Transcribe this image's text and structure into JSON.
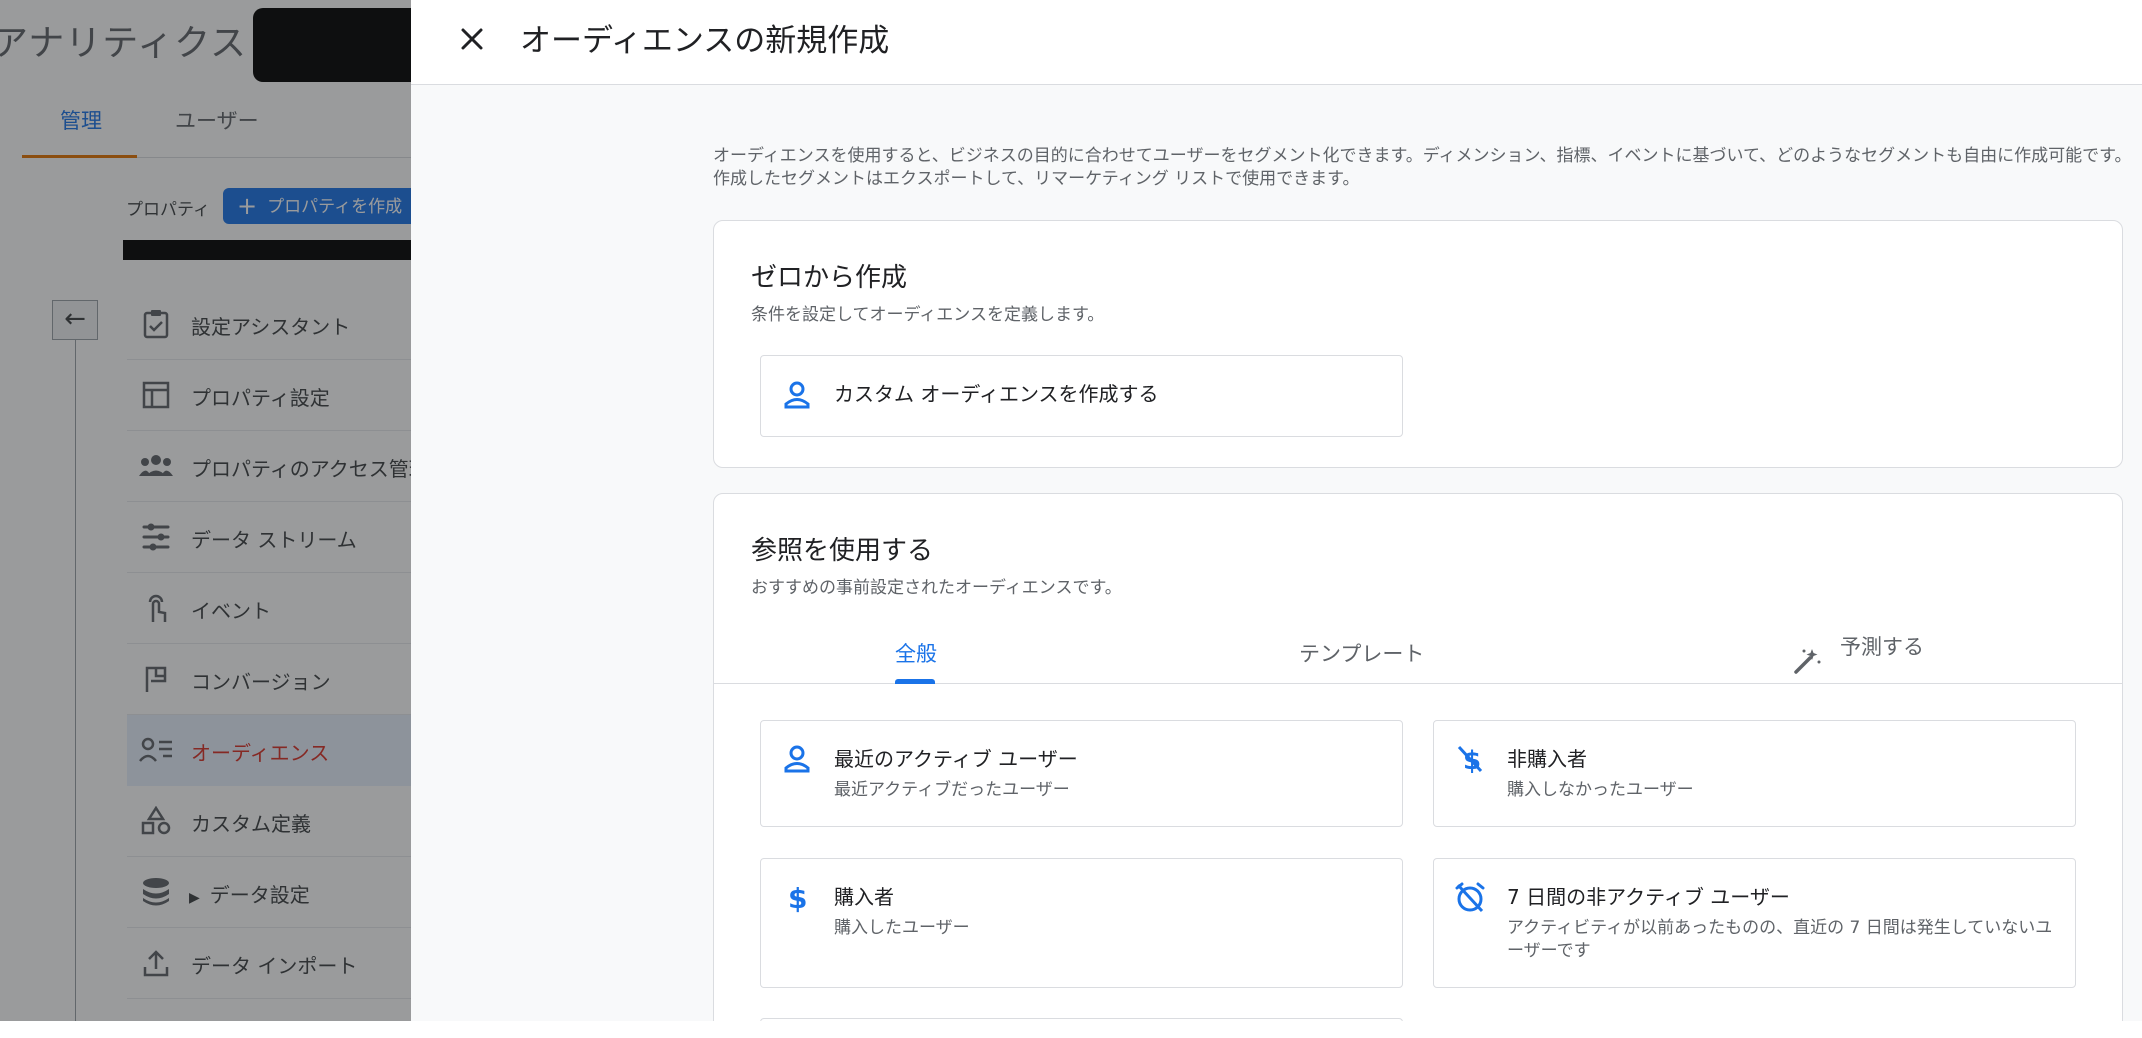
{
  "app": {
    "title": "アナリティクス"
  },
  "background": {
    "tabs": [
      {
        "label": "管理"
      },
      {
        "label": "ユーザー"
      }
    ],
    "property_label": "プロパティ",
    "create_property_label": "プロパティを作成",
    "nav_items": [
      {
        "label": "設定アシスタント",
        "icon": "clipboard-check-icon"
      },
      {
        "label": "プロパティ設定",
        "icon": "layout-icon"
      },
      {
        "label": "プロパティのアクセス管理",
        "icon": "people-icon"
      },
      {
        "label": "データ ストリーム",
        "icon": "stream-icon"
      },
      {
        "label": "イベント",
        "icon": "touch-icon"
      },
      {
        "label": "コンバージョン",
        "icon": "flag-icon"
      },
      {
        "label": "オーディエンス",
        "icon": "audience-icon",
        "active": true
      },
      {
        "label": "カスタム定義",
        "icon": "shapes-icon"
      },
      {
        "label": "データ設定",
        "icon": "database-icon"
      },
      {
        "label": "データ インポート",
        "icon": "upload-icon"
      }
    ]
  },
  "panel": {
    "title": "オーディエンスの新規作成",
    "intro": "オーディエンスを使用すると、ビジネスの目的に合わせてユーザーをセグメント化できます。ディメンション、指標、イベントに基づいて、どのようなセグメントも自由に作成可能です。作成したセグメントはエクスポートして、リマーケティング リストで使用できます。",
    "scratch": {
      "title": "ゼロから作成",
      "subtitle": "条件を設定してオーディエンスを定義します。",
      "custom_option": "カスタム オーディエンスを作成する"
    },
    "reference": {
      "title": "参照を使用する",
      "subtitle": "おすすめの事前設定されたオーディエンスです。",
      "tabs": [
        {
          "label": "全般"
        },
        {
          "label": "テンプレート"
        },
        {
          "label": "予測する"
        }
      ],
      "options": [
        {
          "title": "最近のアクティブ ユーザー",
          "desc": "最近アクティブだったユーザー",
          "icon": "person-icon"
        },
        {
          "title": "非購入者",
          "desc": "購入しなかったユーザー",
          "icon": "money-off-icon"
        },
        {
          "title": "購入者",
          "desc": "購入したユーザー",
          "icon": "dollar-icon"
        },
        {
          "title": "7 日間の非アクティブ ユーザー",
          "desc": "アクティビティが以前あったものの、直近の 7 日間は発生していないユーザーです",
          "icon": "alarm-off-icon"
        }
      ]
    }
  },
  "colors": {
    "accent": "#1a73e8",
    "active_nav": "#d93025",
    "tab_ink_orange": "#e37400"
  }
}
